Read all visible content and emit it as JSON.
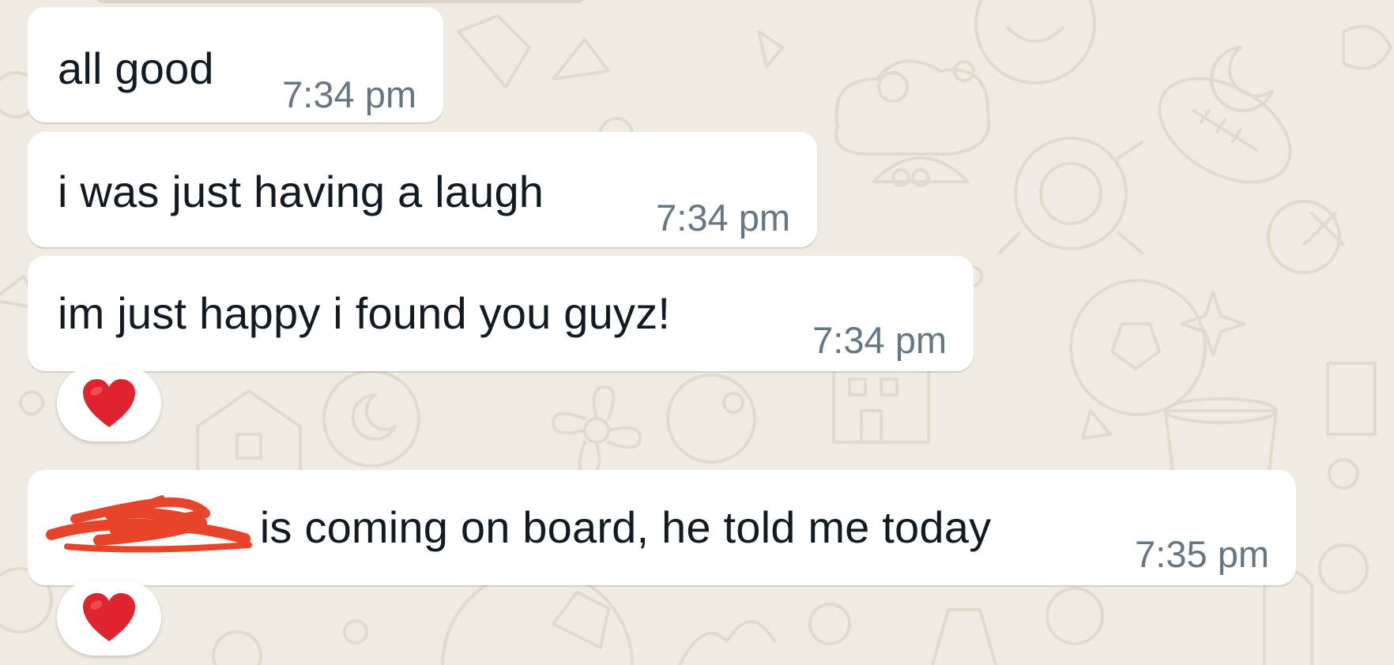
{
  "messages": [
    {
      "text": "all good",
      "time": "7:34 pm"
    },
    {
      "text": "i was just having a laugh",
      "time": "7:34 pm"
    },
    {
      "text": "im just happy i found you guyz!",
      "time": "7:34 pm",
      "reaction": "❤️"
    },
    {
      "redacted_prefix": "",
      "text": "is coming on board, he told me today",
      "time": "7:35 pm",
      "reaction": "❤️"
    }
  ],
  "colors": {
    "chat_background": "#efeae2",
    "bubble": "#ffffff",
    "text": "#111b21",
    "timestamp": "#667781",
    "redaction_scribble": "#e8442a",
    "heart": "#e0242f"
  },
  "icons": {
    "reaction": "heart-icon",
    "redaction": "red-scribble"
  }
}
